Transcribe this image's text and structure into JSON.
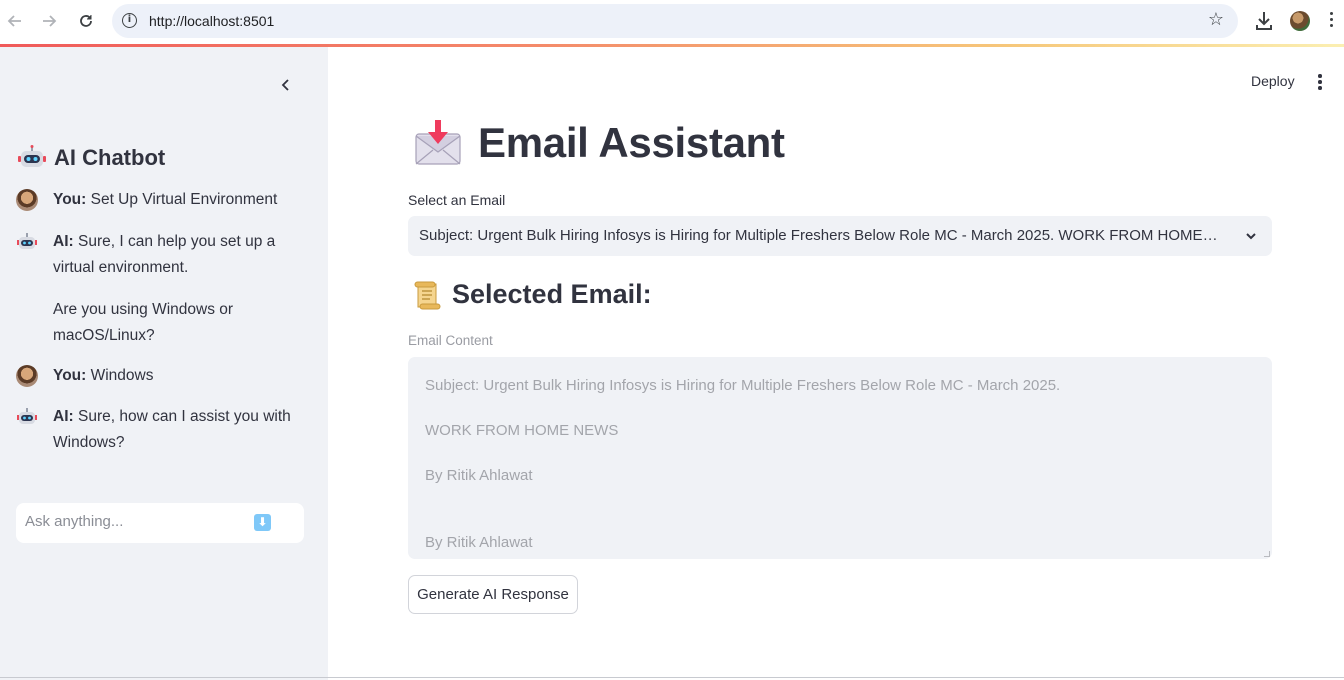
{
  "browser": {
    "url": "http://localhost:8501"
  },
  "sidebar": {
    "title": "AI Chatbot",
    "messages": [
      {
        "role": "user",
        "speaker": "You:",
        "text": "Set Up Virtual Environment"
      },
      {
        "role": "ai",
        "speaker": "AI:",
        "text": "Sure, I can help you set up a virtual environment.",
        "text2": "Are you using Windows or macOS/Linux?"
      },
      {
        "role": "user",
        "speaker": "You:",
        "text": "Windows"
      },
      {
        "role": "ai",
        "speaker": "AI:",
        "text": "Sure, how can I assist you with Windows?"
      }
    ],
    "chat_input": {
      "placeholder": "Ask anything...",
      "value": ""
    }
  },
  "header": {
    "deploy_label": "Deploy"
  },
  "main": {
    "title": "Email Assistant",
    "select_label": "Select an Email",
    "selected_value": "Subject: Urgent Bulk Hiring Infosys is Hiring for Multiple Freshers Below Role MC - March 2025. WORK FROM HOME NEWS By Ritik Ahlawat",
    "subheader": "Selected Email:",
    "content_label": "Email Content",
    "content_lines": [
      "Subject: Urgent Bulk Hiring Infosys is Hiring for Multiple Freshers Below Role MC - March 2025.",
      "WORK FROM HOME NEWS",
      "By Ritik Ahlawat",
      "By Ritik Ahlawat"
    ],
    "generate_button": "Generate AI Response"
  },
  "colors": {
    "sidebar_bg": "#f0f2f6",
    "text": "#31333f",
    "accent_gradient_start": "#f05a5a",
    "accent_gradient_end": "#fbefb2"
  }
}
